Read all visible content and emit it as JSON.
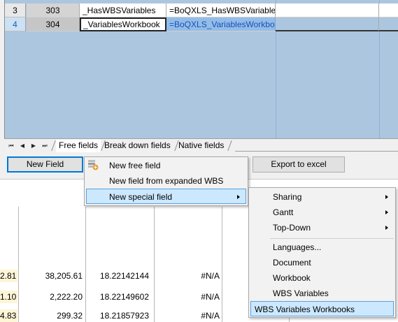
{
  "grid": {
    "rows": [
      {
        "rownum": "3",
        "id": "303",
        "name": "_HasWBSVariables",
        "formula": "=BoQXLS_HasWBSVariables"
      },
      {
        "rownum": "4",
        "id": "304",
        "name": "_VariablesWorkbook",
        "formula": "=BoQXLS_VariablesWorkbook"
      }
    ]
  },
  "tabs": {
    "nav": [
      "⏮",
      "◀",
      "▶",
      "⏭"
    ],
    "items": [
      "Free fields",
      "Break down fields",
      "Native fields"
    ]
  },
  "buttons": {
    "new_field": "New Field",
    "export": "Export to excel"
  },
  "menu1": {
    "items": [
      "New free field",
      "New field from expanded WBS",
      "New special field"
    ]
  },
  "menu2": {
    "items": [
      "Sharing",
      "Gantt",
      "Top-Down",
      "Languages...",
      "Document",
      "Workbook",
      "WBS Variables",
      "WBS Variables Workbooks"
    ]
  },
  "background_sheet": {
    "rows": [
      [
        "2.81",
        "38,205.61",
        "18.22142144",
        "#N/A"
      ],
      [
        "1.10",
        "2,222.20",
        "18.22149602",
        "#N/A"
      ],
      [
        "4.83",
        "299.32",
        "18.21857923",
        "#N/A"
      ]
    ]
  },
  "colors": {
    "grid_background": "#adc6e0",
    "selection_accent": "#0078d7",
    "menu_highlight": "#cce8ff"
  }
}
